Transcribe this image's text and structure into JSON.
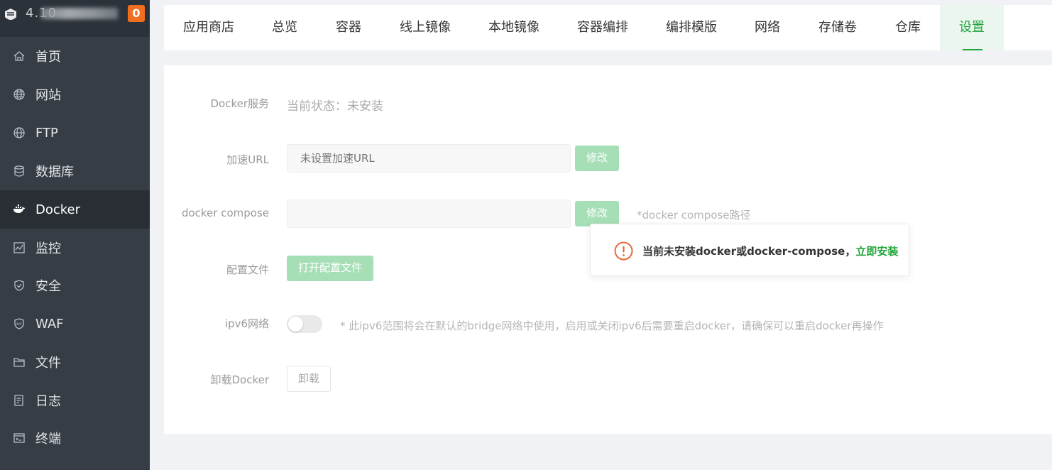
{
  "header": {
    "host_visible": "4.10",
    "notification_count": "0"
  },
  "sidebar": {
    "items": [
      {
        "label": "首页",
        "icon": "home-icon"
      },
      {
        "label": "网站",
        "icon": "globe-icon"
      },
      {
        "label": "FTP",
        "icon": "globe-icon"
      },
      {
        "label": "数据库",
        "icon": "database-icon"
      },
      {
        "label": "Docker",
        "icon": "docker-icon",
        "active": true
      },
      {
        "label": "监控",
        "icon": "monitor-icon"
      },
      {
        "label": "安全",
        "icon": "shield-icon"
      },
      {
        "label": "WAF",
        "icon": "waf-icon"
      },
      {
        "label": "文件",
        "icon": "folder-icon"
      },
      {
        "label": "日志",
        "icon": "log-icon"
      },
      {
        "label": "终端",
        "icon": "terminal-icon"
      }
    ]
  },
  "tabs": [
    {
      "label": "应用商店"
    },
    {
      "label": "总览"
    },
    {
      "label": "容器"
    },
    {
      "label": "线上镜像"
    },
    {
      "label": "本地镜像"
    },
    {
      "label": "容器编排"
    },
    {
      "label": "编排模版"
    },
    {
      "label": "网络"
    },
    {
      "label": "存储卷"
    },
    {
      "label": "仓库"
    },
    {
      "label": "设置",
      "active": true
    }
  ],
  "settings": {
    "docker_service": {
      "label": "Docker服务",
      "status": "当前状态：未安装"
    },
    "mirror_url": {
      "label": "加速URL",
      "placeholder": "未设置加速URL",
      "button": "修改"
    },
    "compose": {
      "label": "docker compose",
      "value": "",
      "button": "修改",
      "hint": "*docker compose路径"
    },
    "config_file": {
      "label": "配置文件",
      "button": "打开配置文件"
    },
    "ipv6": {
      "label": "ipv6网络",
      "enabled": false,
      "hint": "* 此ipv6范围将会在默认的bridge网络中使用，启用或关闭ipv6后需要重启docker，请确保可以重启docker再操作"
    },
    "uninstall": {
      "label": "卸载Docker",
      "button": "卸载"
    }
  },
  "alert": {
    "message": "当前未安装docker或docker-compose，",
    "link": "立即安装",
    "icon": "warning-circle-icon"
  },
  "colors": {
    "sidebar_bg": "#363d45",
    "accent": "#20a53a",
    "badge": "#f26e1f",
    "warning": "#e8693a"
  }
}
